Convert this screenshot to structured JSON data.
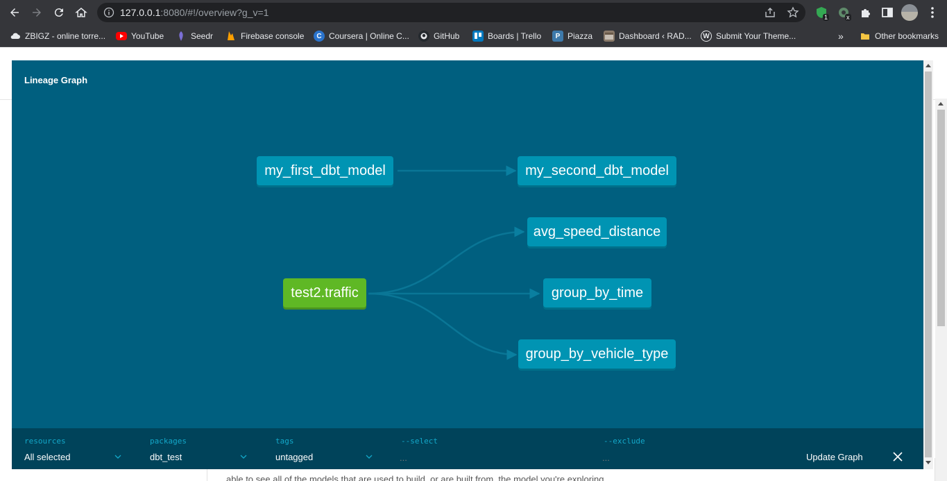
{
  "browser": {
    "url_host": "127.0.0.1",
    "url_rest": ":8080/#!/overview?g_v=1",
    "extension_badge_1": "1",
    "extension_badge_2": "x"
  },
  "bookmarks": [
    {
      "label": "ZBIGZ - online torre...",
      "icon": "cloud-icon",
      "color": "#e8eaed"
    },
    {
      "label": "YouTube",
      "icon": "youtube-icon",
      "color": "#ff0000"
    },
    {
      "label": "Seedr",
      "icon": "seedr-icon",
      "color": "#7b6fd6"
    },
    {
      "label": "Firebase console",
      "icon": "firebase-icon",
      "color": "#ffa000"
    },
    {
      "label": "Coursera | Online C...",
      "icon": "coursera-icon",
      "color": "#2a73cc"
    },
    {
      "label": "GitHub",
      "icon": "github-icon",
      "color": "#24292e"
    },
    {
      "label": "Boards | Trello",
      "icon": "trello-icon",
      "color": "#0079bf"
    },
    {
      "label": "Piazza",
      "icon": "piazza-icon",
      "color": "#3e7aab"
    },
    {
      "label": "Dashboard ‹ RAD...",
      "icon": "dashboard-icon",
      "color": "#8a7a6a"
    },
    {
      "label": "Submit Your Theme...",
      "icon": "wordpress-icon",
      "color": "#e8eaed"
    }
  ],
  "bookmarks_overflow": "»",
  "other_bookmarks": "Other bookmarks",
  "modal": {
    "title": "Lineage Graph"
  },
  "graph": {
    "nodes": {
      "my_first_dbt_model": "my_first_dbt_model",
      "my_second_dbt_model": "my_second_dbt_model",
      "avg_speed_distance": "avg_speed_distance",
      "group_by_time": "group_by_time",
      "group_by_vehicle_type": "group_by_vehicle_type",
      "test2_traffic": "test2.traffic"
    },
    "colors": {
      "model": "#0094b3",
      "source": "#5fb825",
      "background": "#005f7f"
    }
  },
  "controls": {
    "resources": {
      "label": "resources",
      "value": "All selected"
    },
    "packages": {
      "label": "packages",
      "value": "dbt_test"
    },
    "tags": {
      "label": "tags",
      "value": "untagged"
    },
    "select": {
      "label": "--select",
      "placeholder": "..."
    },
    "exclude": {
      "label": "--exclude",
      "placeholder": "..."
    },
    "update_button": "Update Graph"
  },
  "background_page": {
    "text": "able to see all of the models that are used to build, or are built from, the model you're exploring."
  }
}
